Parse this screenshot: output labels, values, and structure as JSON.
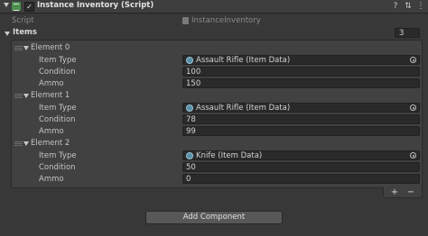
{
  "component": {
    "title": "Instance Inventory (Script)",
    "enabled_mark": "✓",
    "help_glyph": "?",
    "preset_glyph": "⇅",
    "menu_glyph": "⋮"
  },
  "script_row": {
    "label": "Script",
    "value": "InstanceInventory"
  },
  "items": {
    "label": "Items",
    "size": "3",
    "elements": [
      {
        "header": "Element 0",
        "fields": [
          {
            "label": "Item Type",
            "value": "Assault Rifle (Item Data)"
          },
          {
            "label": "Condition",
            "value": "100"
          },
          {
            "label": "Ammo",
            "value": "150"
          }
        ]
      },
      {
        "header": "Element 1",
        "fields": [
          {
            "label": "Item Type",
            "value": "Assault Rifle (Item Data)"
          },
          {
            "label": "Condition",
            "value": "78"
          },
          {
            "label": "Ammo",
            "value": "99"
          }
        ]
      },
      {
        "header": "Element 2",
        "fields": [
          {
            "label": "Item Type",
            "value": "Knife (Item Data)"
          },
          {
            "label": "Condition",
            "value": "50"
          },
          {
            "label": "Ammo",
            "value": "0"
          }
        ]
      }
    ],
    "add_glyph": "+",
    "remove_glyph": "−"
  },
  "add_component_label": "Add Component",
  "icons": {
    "foldout": "foldout-triangle-icon",
    "script": "script-icon",
    "object_field": "scriptable-object-icon",
    "picker": "object-picker-icon",
    "drag": "drag-handle-icon"
  },
  "colors": {
    "background": "#383838",
    "header": "#3e3e3e",
    "field": "#2a2a2a",
    "list_box": "#414141",
    "button": "#585858",
    "text": "#c4c4c4"
  }
}
